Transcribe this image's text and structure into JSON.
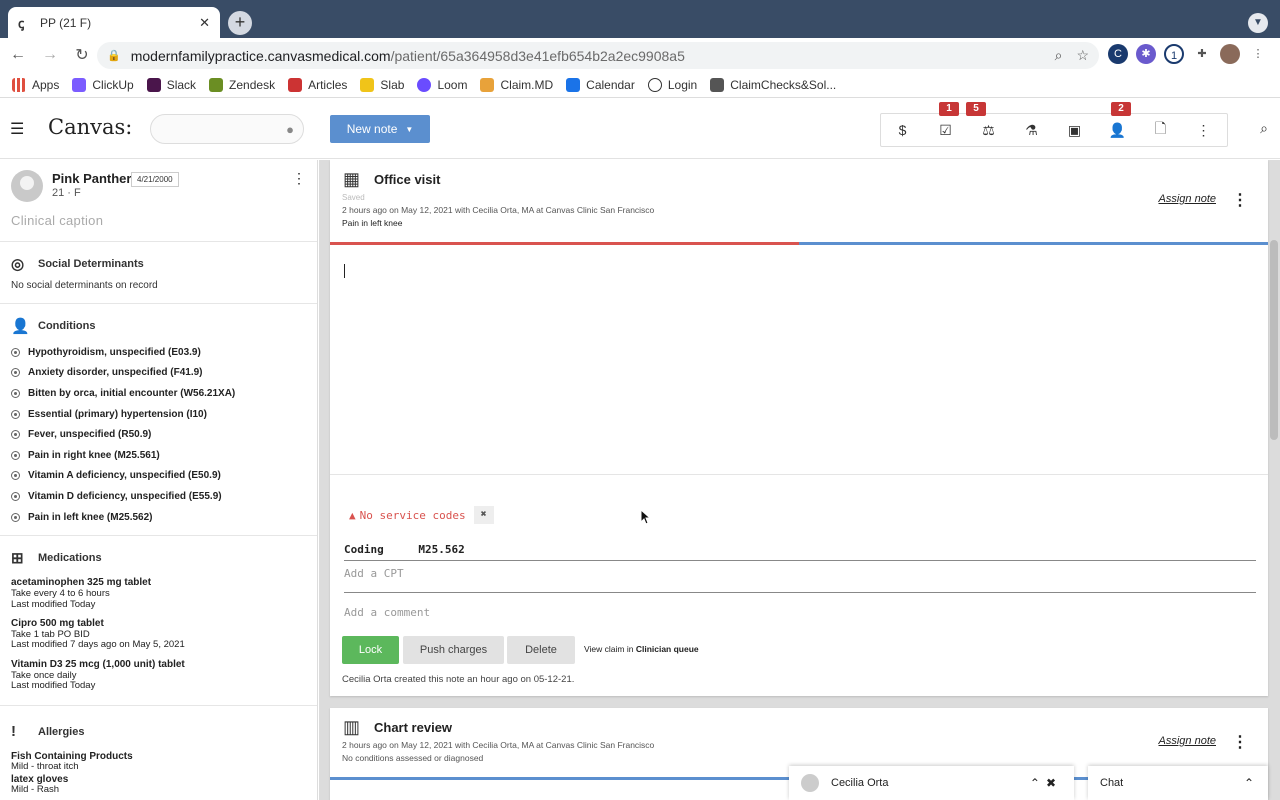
{
  "browser": {
    "tab_title": "PP (21 F)",
    "url_domain": "modernfamilypractice.canvasmedical.com",
    "url_path": "/patient/65a364958d3e41efb654b2a2ec9908a5",
    "bookmarks": [
      "Apps",
      "ClickUp",
      "Slack",
      "Zendesk",
      "Articles",
      "Slab",
      "Loom",
      "Claim.MD",
      "Calendar",
      "Login",
      "ClaimChecks&Sol..."
    ],
    "bookmark_colors": [
      "#e04f3f",
      "#7b5cff",
      "#4a154b",
      "#6b8e23",
      "#cc3333",
      "#f0c419",
      "#6a4cff",
      "#e8a23a",
      "#1a73e8",
      "#333333",
      "#555555"
    ]
  },
  "header": {
    "logo": "Canvas:",
    "new_note_label": "New note",
    "badges": {
      "b1": "1",
      "b2": "5",
      "b3": "2"
    }
  },
  "patient": {
    "name": "Pink Panther",
    "dob": "4/21/2000",
    "age_sex": "21 · F",
    "caption": "Clinical caption"
  },
  "sections": {
    "social_title": "Social Determinants",
    "social_empty": "No social determinants on record",
    "conditions_title": "Conditions",
    "conditions": [
      "Hypothyroidism, unspecified (E03.9)",
      "Anxiety disorder, unspecified (F41.9)",
      "Bitten by orca, initial encounter (W56.21XA)",
      "Essential (primary) hypertension (I10)",
      "Fever, unspecified (R50.9)",
      "Pain in right knee (M25.561)",
      "Vitamin A deficiency, unspecified (E50.9)",
      "Vitamin D deficiency, unspecified (E55.9)",
      "Pain in left knee (M25.562)"
    ],
    "medications_title": "Medications",
    "medications": [
      {
        "name": "acetaminophen 325 mg tablet",
        "sig": "Take every 4 to 6 hours",
        "modified": "Last modified Today"
      },
      {
        "name": "Cipro 500 mg tablet",
        "sig": "Take 1 tab PO BID",
        "modified": "Last modified 7 days ago on May 5, 2021"
      },
      {
        "name": "Vitamin D3 25 mcg (1,000 unit) tablet",
        "sig": "Take once daily",
        "modified": "Last modified Today"
      }
    ],
    "allergies_title": "Allergies",
    "allergies": [
      {
        "name": "Fish Containing Products",
        "detail": "Mild - throat itch"
      },
      {
        "name": "latex gloves",
        "detail": "Mild - Rash"
      }
    ]
  },
  "note1": {
    "title": "Office visit",
    "status": "Saved",
    "meta": "2 hours ago on May 12, 2021 with Cecilia Orta, MA at Canvas Clinic San Francisco",
    "reason": "Pain in left knee",
    "assign": "Assign note",
    "warning": "No service codes",
    "coding_label": "Coding",
    "coding_value": "M25.562",
    "cpt_placeholder": "Add a CPT",
    "comment_placeholder": "Add a comment",
    "lock": "Lock",
    "push": "Push charges",
    "delete": "Delete",
    "view_claim_prefix": "View claim in",
    "view_claim_link": "Clinician queue",
    "created": "Cecilia Orta created this note an hour ago on 05-12-21."
  },
  "note2": {
    "title": "Chart review",
    "meta": "2 hours ago on May 12, 2021 with Cecilia Orta, MA at Canvas Clinic San Francisco",
    "reason": "No conditions assessed or diagnosed",
    "assign": "Assign note"
  },
  "chat": {
    "user": "Cecilia Orta",
    "label": "Chat"
  }
}
